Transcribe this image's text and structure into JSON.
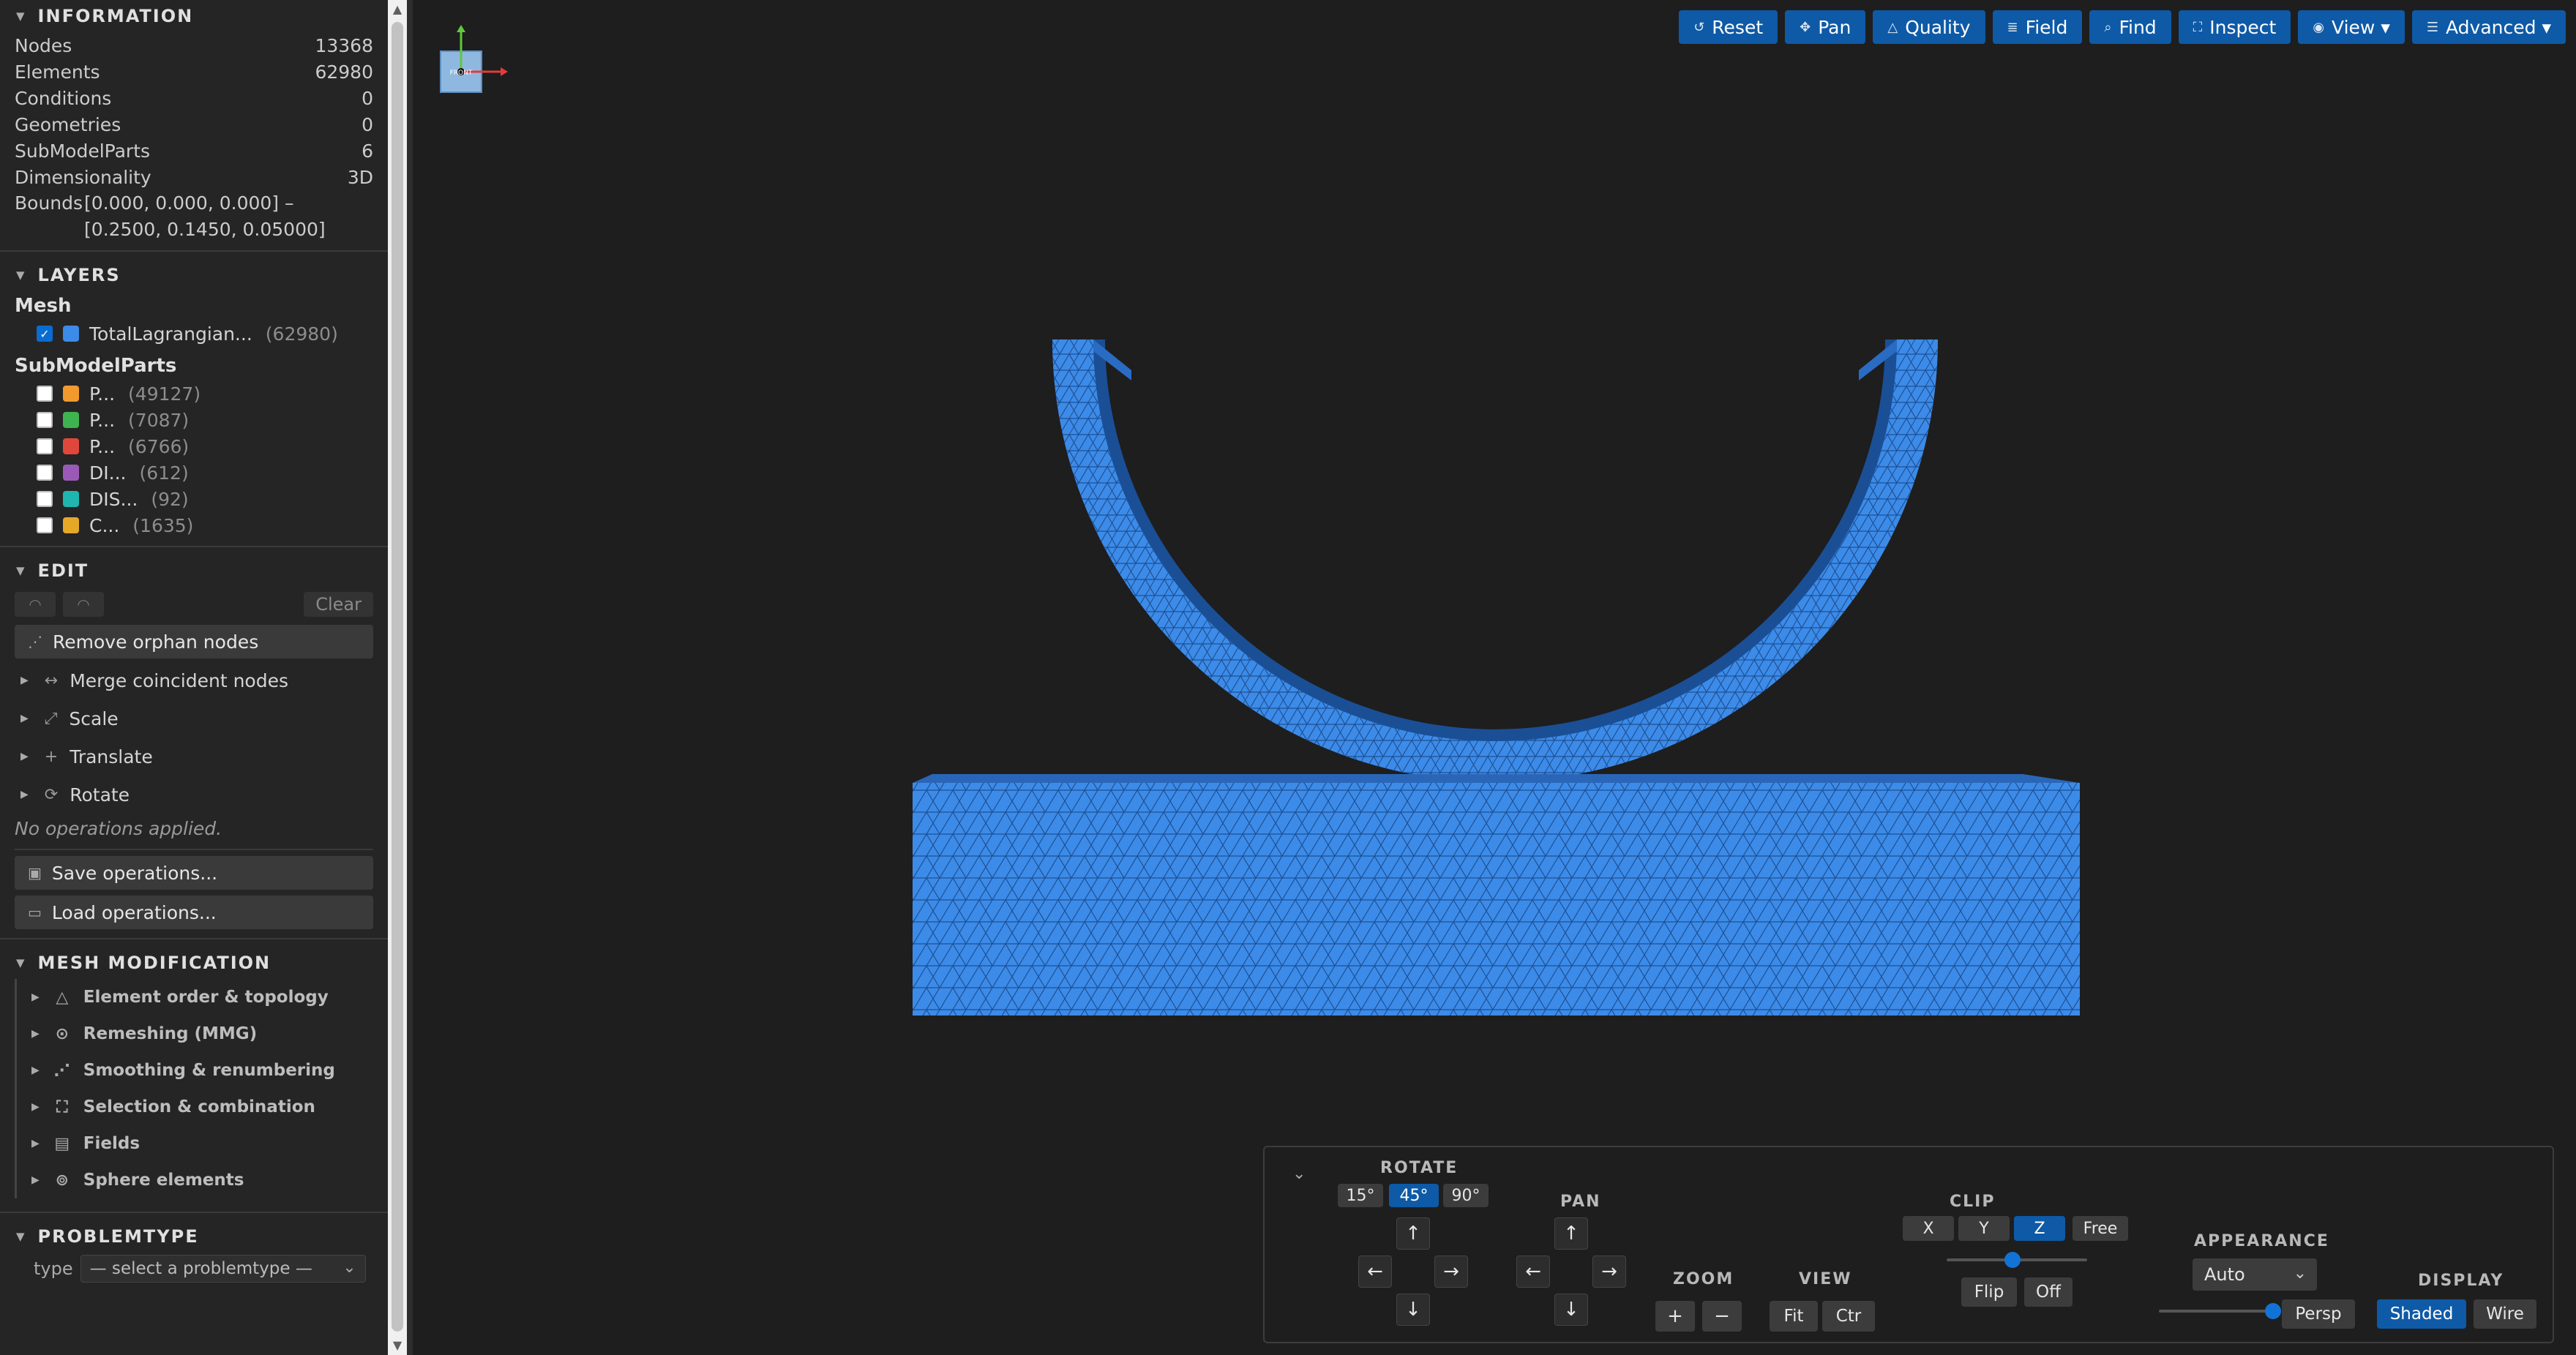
{
  "info": {
    "title": "INFORMATION",
    "rows": [
      {
        "label": "Nodes",
        "value": "13368"
      },
      {
        "label": "Elements",
        "value": "62980"
      },
      {
        "label": "Conditions",
        "value": "0"
      },
      {
        "label": "Geometries",
        "value": "0"
      },
      {
        "label": "SubModelParts",
        "value": "6"
      },
      {
        "label": "Dimensionality",
        "value": "3D"
      }
    ],
    "bounds_label": "Bounds",
    "bounds_value": "[0.000, 0.000, 0.000] – [0.2500, 0.1450, 0.05000]"
  },
  "layers": {
    "title": "LAYERS",
    "mesh_group": "Mesh",
    "mesh_items": [
      {
        "name": "TotalLagrangian...",
        "count": "(62980)",
        "color": "#3c8be8",
        "checked": true
      }
    ],
    "smp_group": "SubModelParts",
    "smp_items": [
      {
        "name": "P...",
        "count": "(49127)",
        "color": "#f29a2e",
        "checked": false
      },
      {
        "name": "P...",
        "count": "(7087)",
        "color": "#3fb34f",
        "checked": false
      },
      {
        "name": "P...",
        "count": "(6766)",
        "color": "#e0473c",
        "checked": false
      },
      {
        "name": "DI...",
        "count": "(612)",
        "color": "#9b59b6",
        "checked": false
      },
      {
        "name": "DIS...",
        "count": "(92)",
        "color": "#1fb5b0",
        "checked": false
      },
      {
        "name": "C...",
        "count": "(1635)",
        "color": "#e5a827",
        "checked": false
      }
    ]
  },
  "edit": {
    "title": "EDIT",
    "clear_label": "Clear",
    "remove_orphan": "Remove orphan nodes",
    "ops": [
      {
        "label": "Merge coincident nodes",
        "icon": "merge-icon"
      },
      {
        "label": "Scale",
        "icon": "scale-icon"
      },
      {
        "label": "Translate",
        "icon": "translate-icon"
      },
      {
        "label": "Rotate",
        "icon": "rotate-icon"
      }
    ],
    "no_ops": "No operations applied.",
    "save_ops": "Save operations...",
    "load_ops": "Load operations..."
  },
  "mesh_mod": {
    "title": "MESH MODIFICATION",
    "items": [
      {
        "label": "Element order & topology",
        "icon": "triangle-icon"
      },
      {
        "label": "Remeshing (MMG)",
        "icon": "remesh-icon"
      },
      {
        "label": "Smoothing & renumbering",
        "icon": "smooth-icon"
      },
      {
        "label": "Selection & combination",
        "icon": "selection-icon"
      },
      {
        "label": "Fields",
        "icon": "fields-icon"
      },
      {
        "label": "Sphere elements",
        "icon": "sphere-icon"
      }
    ]
  },
  "problemtype": {
    "title": "PROBLEMTYPE",
    "type_label": "type",
    "select_value": "— select a problemtype —"
  },
  "toolbar": {
    "reset": "Reset",
    "pan": "Pan",
    "quality": "Quality",
    "field": "Field",
    "find": "Find",
    "inspect": "Inspect",
    "view": "View ▾",
    "advanced": "Advanced ▾"
  },
  "axes": {
    "label": "FRONT",
    "x_color": "#e33b3b",
    "y_color": "#5fc93a"
  },
  "mesh_color": "#3c8be8",
  "panel": {
    "rotate_title": "ROTATE",
    "rotate_steps": [
      "15°",
      "45°",
      "90°"
    ],
    "active_step": "45°",
    "pan_title": "PAN",
    "zoom_title": "ZOOM",
    "zoom_in": "+",
    "zoom_out": "−",
    "view_title": "VIEW",
    "fit": "Fit",
    "ctr": "Ctr",
    "clip_title": "CLIP",
    "clip_axes": [
      "X",
      "Y",
      "Z",
      "Free"
    ],
    "active_clip": "Z",
    "clip_level": 0.47,
    "flip": "Flip",
    "off": "Off",
    "appearance_title": "APPEARANCE",
    "appearance_value": "Auto",
    "persp": "Persp",
    "persp_level": 1.0,
    "display_title": "DISPLAY",
    "shaded": "Shaded",
    "wire": "Wire",
    "arrow_up": "↑",
    "arrow_down": "↓",
    "arrow_left": "←",
    "arrow_right": "→"
  }
}
